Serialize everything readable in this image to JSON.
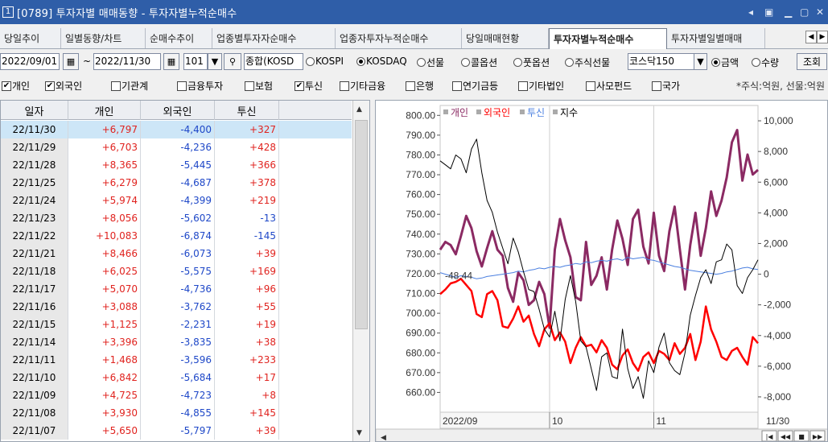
{
  "window": {
    "title_num": "1",
    "title": "[0789] 투자자별 매매동향 - 투자자별누적순매수"
  },
  "tabs": [
    "당일추이",
    "일별동향/차트",
    "순매수추이",
    "업종별투자자순매수",
    "업종자투자누적순매수",
    "당일매매현황",
    "투자자별누적순매수",
    "투자자별일별매매"
  ],
  "active_tab": 6,
  "toolbar": {
    "start_date": "2022/09/01",
    "tilde": "~",
    "end_date": "2022/11/30",
    "code": "101",
    "sector": "종합(KOSD",
    "radio_market": [
      {
        "label": "KOSPI",
        "on": false
      },
      {
        "label": "KOSDAQ",
        "on": true
      },
      {
        "label": "선물",
        "on": false
      },
      {
        "label": "콜옵션",
        "on": false
      },
      {
        "label": "풋옵션",
        "on": false
      },
      {
        "label": "주식선물",
        "on": false
      }
    ],
    "combo_kosdaq": "코스닥150",
    "radio_unit": [
      {
        "label": "금액",
        "on": true
      },
      {
        "label": "수량",
        "on": false
      }
    ],
    "query_label": "조회"
  },
  "checks": [
    {
      "label": "개인",
      "on": true
    },
    {
      "label": "외국인",
      "on": true
    },
    {
      "label": "기관계",
      "on": false
    },
    {
      "label": "금융투자",
      "on": false
    },
    {
      "label": "보험",
      "on": false
    },
    {
      "label": "투신",
      "on": true
    },
    {
      "label": "기타금융",
      "on": false
    },
    {
      "label": "은행",
      "on": false
    },
    {
      "label": "연기금등",
      "on": false
    },
    {
      "label": "기타법인",
      "on": false
    },
    {
      "label": "사모펀드",
      "on": false
    },
    {
      "label": "국가",
      "on": false
    }
  ],
  "unit_note": "*주식:억원, 선물:억원",
  "table": {
    "columns": [
      "일자",
      "개인",
      "외국인",
      "투신"
    ],
    "rows": [
      [
        "22/11/30",
        "+6,797",
        "-4,400",
        "+327"
      ],
      [
        "22/11/29",
        "+6,703",
        "-4,236",
        "+428"
      ],
      [
        "22/11/28",
        "+8,365",
        "-5,445",
        "+366"
      ],
      [
        "22/11/25",
        "+6,279",
        "-4,687",
        "+378"
      ],
      [
        "22/11/24",
        "+5,974",
        "-4,399",
        "+219"
      ],
      [
        "22/11/23",
        "+8,056",
        "-5,602",
        "-13"
      ],
      [
        "22/11/22",
        "+10,083",
        "-6,874",
        "-145"
      ],
      [
        "22/11/21",
        "+8,466",
        "-6,073",
        "+39"
      ],
      [
        "22/11/18",
        "+6,025",
        "-5,575",
        "+169"
      ],
      [
        "22/11/17",
        "+5,070",
        "-4,736",
        "+96"
      ],
      [
        "22/11/16",
        "+3,088",
        "-3,762",
        "+55"
      ],
      [
        "22/11/15",
        "+1,125",
        "-2,231",
        "+19"
      ],
      [
        "22/11/14",
        "+3,396",
        "-3,835",
        "+38"
      ],
      [
        "22/11/11",
        "+1,468",
        "-3,596",
        "+233"
      ],
      [
        "22/11/10",
        "+6,842",
        "-5,684",
        "+17"
      ],
      [
        "22/11/09",
        "+4,725",
        "-4,723",
        "+8"
      ],
      [
        "22/11/08",
        "+3,930",
        "-4,855",
        "+145"
      ],
      [
        "22/11/07",
        "+5,650",
        "-5,797",
        "+39"
      ]
    ]
  },
  "colors": {
    "individual": "#8b2a63",
    "foreign": "#ff0000",
    "trust": "#4a7fe0",
    "index": "#000000",
    "pos": "#e0231f",
    "neg": "#1f48c8"
  },
  "chart_data": {
    "type": "line",
    "legend": [
      {
        "name": "개인",
        "color": "#8b2a63"
      },
      {
        "name": "외국인",
        "color": "#ff0000"
      },
      {
        "name": "투신",
        "color": "#4a7fe0"
      },
      {
        "name": "지수",
        "color": "#000000"
      }
    ],
    "left_ticks": [
      "800.00",
      "790.00",
      "780.00",
      "770.00",
      "760.00",
      "750.00",
      "740.00",
      "730.00",
      "720.00",
      "710.00",
      "700.00",
      "690.00",
      "680.00",
      "670.00",
      "660.00"
    ],
    "right_ticks": [
      "10,000",
      "8,000",
      "6,000",
      "4,000",
      "2,000",
      "0",
      "-2,000",
      "-4,000",
      "-6,000",
      "-8,000"
    ],
    "left_ylim": [
      650,
      805
    ],
    "right_ylim": [
      -9000,
      11000
    ],
    "x_ticks": [
      "2022/09",
      "10",
      "11",
      "11/30"
    ],
    "marker_label": "-48.44",
    "n": 62,
    "x_tick_index": [
      0,
      21,
      41,
      61
    ],
    "series": [
      {
        "name": "개인",
        "values": [
          1600,
          2100,
          1900,
          1300,
          2500,
          3800,
          3000,
          1500,
          500,
          1700,
          2800,
          1600,
          1200,
          -900,
          -1800,
          100,
          -400,
          -2000,
          -1700,
          -500,
          -1300,
          -3500,
          1600,
          3600,
          2200,
          1100,
          -1500,
          -1700,
          2100,
          -700,
          -100,
          1100,
          -1000,
          1600,
          3500,
          2300,
          600,
          3600,
          4200,
          1800,
          700,
          4000,
          1200,
          200,
          2800,
          4400,
          1600,
          -1000,
          1900,
          4000,
          1200,
          3000,
          5400,
          3800,
          4800,
          6300,
          8600,
          9400,
          6100,
          7800,
          6500,
          6800
        ]
      },
      {
        "name": "외국인",
        "values": [
          -1300,
          -1000,
          -600,
          -500,
          -300,
          -700,
          -1100,
          -2600,
          -2800,
          -1300,
          -1100,
          -1700,
          -3400,
          -3500,
          -2900,
          -2100,
          -3100,
          -2700,
          -3900,
          -4700,
          -3600,
          -3200,
          -4300,
          -3800,
          -4400,
          -5800,
          -4800,
          -4100,
          -4700,
          -4600,
          -5100,
          -4300,
          -4800,
          -5900,
          -6200,
          -5300,
          -4900,
          -5800,
          -6300,
          -5400,
          -5100,
          -5800,
          -5000,
          -5200,
          -5600,
          -4500,
          -5200,
          -4800,
          -3900,
          -5600,
          -4400,
          -2100,
          -3600,
          -4400,
          -5400,
          -5600,
          -5000,
          -4800,
          -5400,
          -5900,
          -4100,
          -4500
        ]
      },
      {
        "name": "투신",
        "values": [
          100,
          0,
          -100,
          -200,
          -100,
          -150,
          -200,
          -300,
          -250,
          -150,
          -100,
          -50,
          0,
          50,
          100,
          200,
          150,
          250,
          300,
          400,
          350,
          450,
          500,
          450,
          550,
          600,
          700,
          650,
          800,
          750,
          850,
          900,
          850,
          950,
          1000,
          900,
          1100,
          1000,
          1050,
          1100,
          950,
          900,
          800,
          700,
          600,
          500,
          450,
          350,
          250,
          200,
          150,
          100,
          50,
          0,
          50,
          150,
          200,
          300,
          400,
          450,
          350,
          300
        ]
      },
      {
        "name": "지수",
        "values": [
          777,
          775,
          773,
          780,
          778,
          771,
          783,
          788,
          771,
          757,
          751,
          741,
          733,
          725,
          738,
          731,
          721,
          712,
          711,
          702,
          692,
          688,
          701,
          686,
          707,
          719,
          706,
          686,
          683,
          672,
          661,
          678,
          680,
          668,
          667,
          692,
          672,
          662,
          668,
          657,
          676,
          670,
          683,
          690,
          675,
          671,
          669,
          680,
          699,
          709,
          718,
          722,
          715,
          726,
          727,
          735,
          732,
          714,
          710,
          718,
          722,
          727
        ]
      }
    ]
  }
}
